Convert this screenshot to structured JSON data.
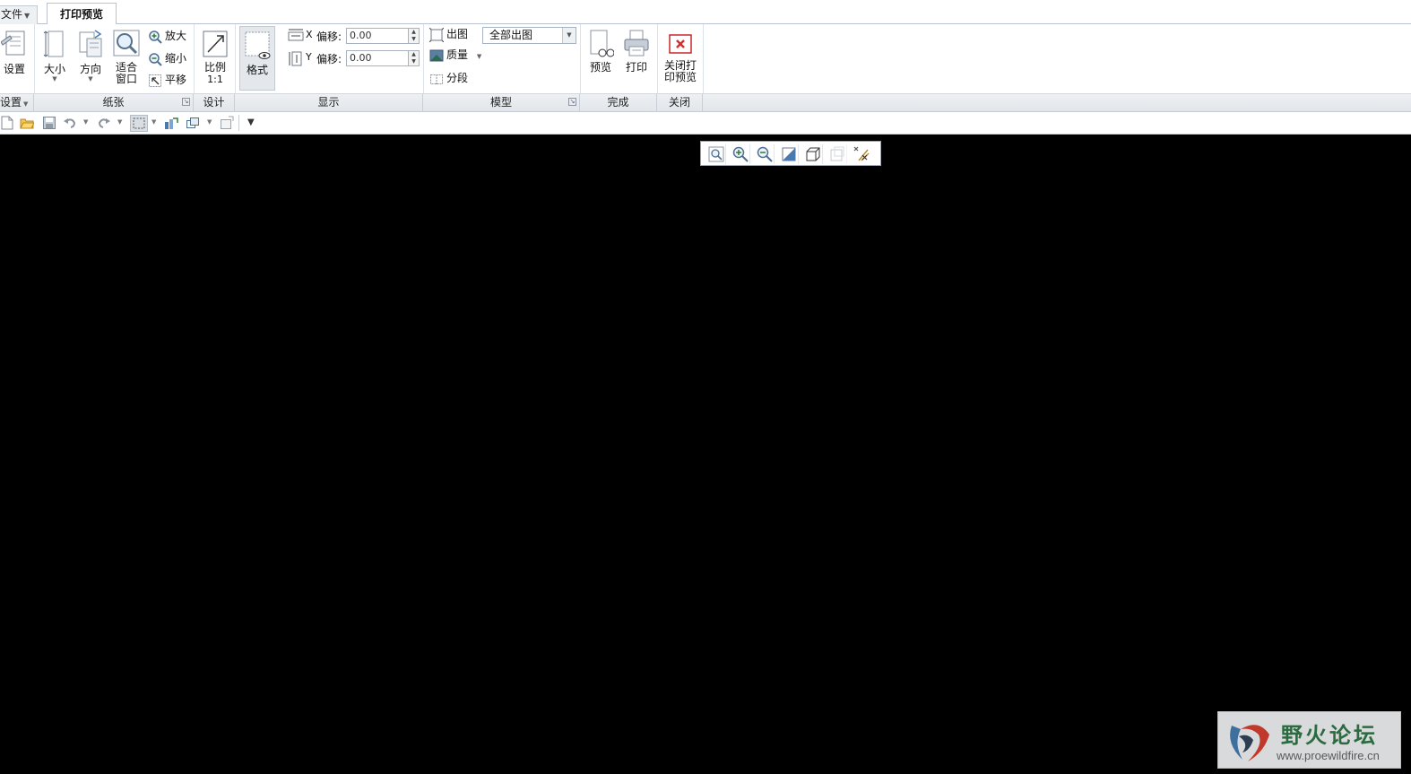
{
  "tabs": {
    "file": "文件",
    "active": "打印预览"
  },
  "ribbon": {
    "settings_btn": "设置",
    "paper": {
      "size": "大小",
      "orientation": "方向",
      "fit_line1": "适合",
      "fit_line2": "窗口",
      "zoom_in": "放大",
      "zoom_out": "缩小",
      "pan": "平移"
    },
    "design": {
      "scale_line1": "比例",
      "scale_line2": "1:1"
    },
    "format_btn": "格式",
    "display": {
      "x_label": "X",
      "y_label": "Y",
      "offset_label": "偏移:",
      "x_value": "0.00",
      "y_value": "0.00"
    },
    "model": {
      "output": "出图",
      "quality": "质量",
      "segment": "分段",
      "output_combo": "全部出图"
    },
    "finish": {
      "preview": "预览",
      "print": "打印"
    },
    "close": {
      "close_line1": "关闭打",
      "close_line2": "印预览"
    }
  },
  "groups": {
    "settings": "设置",
    "paper": "纸张",
    "design": "设计",
    "display": "显示",
    "model": "模型",
    "finish": "完成",
    "close": "关闭"
  },
  "watermark": {
    "title": "野火论坛",
    "url": "www.proewildfire.cn"
  },
  "colors": {
    "accent": "#d32f2f",
    "canvas": "#000000",
    "ribbon_bg": "#ffffff",
    "group_bar": "#e6e9ed"
  }
}
